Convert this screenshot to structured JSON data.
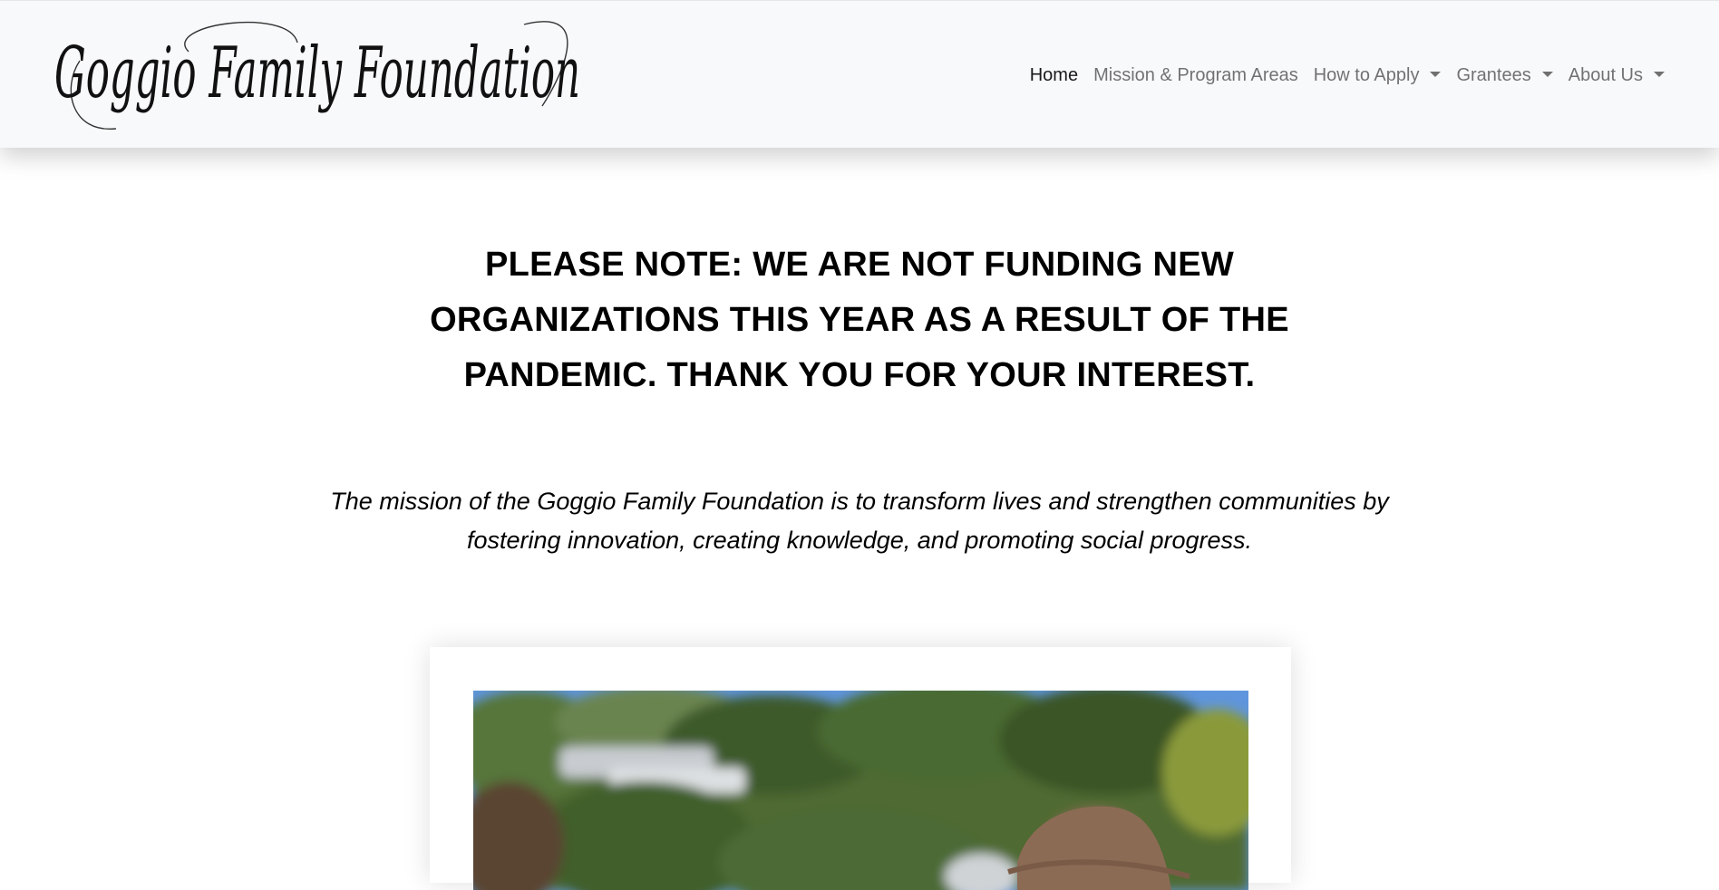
{
  "brand": {
    "logo_text": "Goggio Family Foundation"
  },
  "nav": {
    "items": [
      {
        "label": "Home",
        "active": true,
        "dropdown": false
      },
      {
        "label": "Mission & Program Areas",
        "active": false,
        "dropdown": false
      },
      {
        "label": "How to Apply",
        "active": false,
        "dropdown": true
      },
      {
        "label": "Grantees",
        "active": false,
        "dropdown": true
      },
      {
        "label": "About Us",
        "active": false,
        "dropdown": true
      }
    ]
  },
  "main": {
    "notice": "PLEASE NOTE: WE ARE NOT FUNDING NEW ORGANIZATIONS THIS YEAR AS A RESULT OF THE PANDEMIC. THANK YOU FOR YOUR INTEREST.",
    "mission": "The mission of the Goggio Family Foundation is to transform lives and strengthen communities by fostering innovation, creating knowledge, and promoting social progress."
  },
  "colors": {
    "navbar_bg": "#f8f9fa",
    "nav_link": "#737373",
    "nav_active": "#1a1a1a",
    "text": "#000000"
  }
}
